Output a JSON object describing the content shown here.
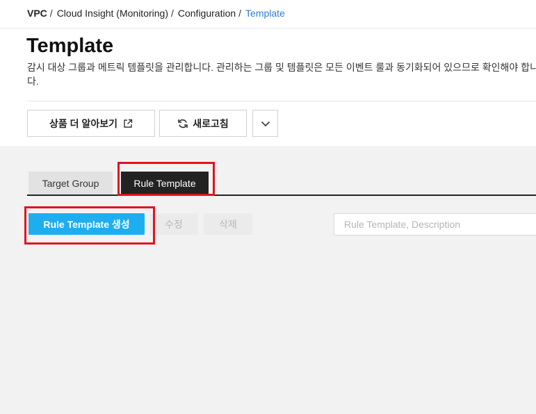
{
  "breadcrumb": {
    "items": [
      "VPC",
      "Cloud Insight (Monitoring)",
      "Configuration",
      "Template"
    ],
    "separator": "/"
  },
  "header": {
    "title": "Template",
    "description": "감시 대상 그룹과 메트릭 템플릿을 관리합니다. 관리하는 그룹 및 템플릿은 모든 이벤트 룰과 동기화되어 있으므로 확인해야 합니다."
  },
  "toolbar": {
    "learn_more_label": "상품 더 알아보기",
    "refresh_label": "새로고침",
    "learn_more_icon": "external-link-icon",
    "refresh_icon": "refresh-icon",
    "more_icon": "chevron-down-icon"
  },
  "tabs": [
    {
      "label": "Target Group",
      "active": false
    },
    {
      "label": "Rule Template",
      "active": true
    }
  ],
  "actions": {
    "create_label": "Rule Template 생성",
    "edit_label": "수정",
    "delete_label": "삭제"
  },
  "search": {
    "placeholder": "Rule Template, Description",
    "value": ""
  },
  "colors": {
    "accent": "#1eaef0",
    "link": "#2e7dd1",
    "highlight": "#e1131e",
    "active_tab": "#222222"
  }
}
